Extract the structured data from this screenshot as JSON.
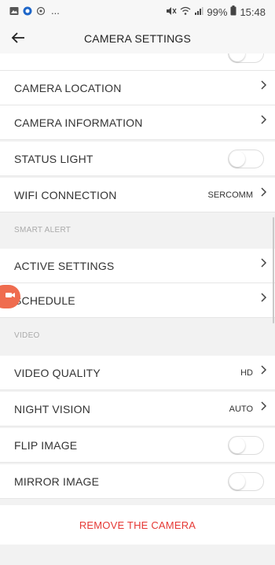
{
  "status_bar": {
    "left_icons": [
      "gallery-icon",
      "blue-circle-icon",
      "sync-icon"
    ],
    "dots": "...",
    "right_icons": [
      "mute-icon",
      "wifi-icon",
      "signal-icon"
    ],
    "battery": "99%",
    "battery_icon": "battery-icon",
    "time": "15:48"
  },
  "header": {
    "back_icon": "arrow-left-icon",
    "title": "CAMERA SETTINGS"
  },
  "rows": {
    "camera_location": "CAMERA LOCATION",
    "camera_information": "CAMERA INFORMATION",
    "status_light": "STATUS LIGHT",
    "wifi_connection": "WIFI CONNECTION",
    "wifi_value": "SERCOMM",
    "active_settings": "ACTIVE SETTINGS",
    "schedule": "SCHEDULE",
    "video_quality": "VIDEO QUALITY",
    "video_quality_value": "HD",
    "night_vision": "NIGHT VISION",
    "night_vision_value": "AUTO",
    "flip_image": "FLIP IMAGE",
    "mirror_image": "MIRROR IMAGE"
  },
  "sections": {
    "smart_alert": "SMART ALERT",
    "video": "VIDEO"
  },
  "toggles": {
    "status_light": false,
    "flip_image": false,
    "mirror_image": false
  },
  "remove_label": "REMOVE THE CAMERA",
  "colors": {
    "accent_red": "#e53935",
    "floating_badge": "#ef6c4f",
    "background": "#f2f2f2"
  }
}
